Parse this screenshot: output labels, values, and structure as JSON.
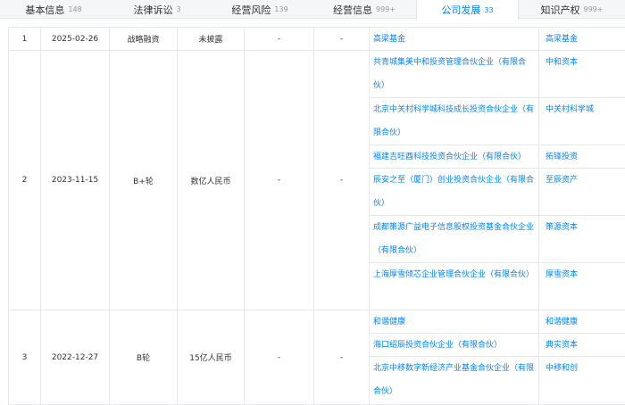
{
  "tabs": [
    {
      "label": "基本信息",
      "count": "148"
    },
    {
      "label": "法律诉讼",
      "count": "3"
    },
    {
      "label": "经营风险",
      "count": "139"
    },
    {
      "label": "经营信息",
      "count": "999+"
    },
    {
      "label": "公司发展",
      "count": "33"
    },
    {
      "label": "知识产权",
      "count": "999+"
    }
  ],
  "rows": [
    {
      "index": "1",
      "date": "2025-02-26",
      "round": "战略融资",
      "amount": "未披露",
      "valuation": "-",
      "ratio": "-",
      "investors": [
        {
          "name": "高梁基金",
          "firm": "高梁基金"
        }
      ]
    },
    {
      "index": "2",
      "date": "2023-11-15",
      "round": "B+轮",
      "amount": "数亿人民币",
      "valuation": "-",
      "ratio": "-",
      "investors": [
        {
          "name": "共青城集美中和投资管理合伙企业（有限合伙）",
          "firm": "中和资本"
        },
        {
          "name": "北京中关村科学城科技成长投资合伙企业（有限合伙）",
          "firm": "中关村科学城"
        },
        {
          "name": "福建吉旺酉科技投资合伙企业（有限合伙）",
          "firm": "拓锋投资"
        },
        {
          "name": "辰安之至（厦门）创业投资合伙企业（有限合伙）",
          "firm": "至辰资产"
        },
        {
          "name": "成都策源广益电子信息股权投资基金合伙企业（有限合伙）",
          "firm": "策源资本"
        },
        {
          "name": "上海厚雪倾芯企业管理合伙企业（有限合伙）",
          "firm": "厚雪资本"
        }
      ]
    },
    {
      "index": "3",
      "date": "2022-12-27",
      "round": "B轮",
      "amount": "15亿人民币",
      "valuation": "-",
      "ratio": "-",
      "investors": [
        {
          "name": "和谐健康",
          "firm": "和谐健康"
        },
        {
          "name": "海口绍辰投资合伙企业（有限合伙）",
          "firm": "典实资本"
        },
        {
          "name": "北京中移数字新经济产业基金合伙企业（有限合伙）",
          "firm": "中移和创"
        }
      ]
    }
  ],
  "colors": {
    "accent": "#0084ff",
    "border": "#e4e7ec",
    "tab_bg": "#f5f6f8",
    "muted": "#999999"
  }
}
